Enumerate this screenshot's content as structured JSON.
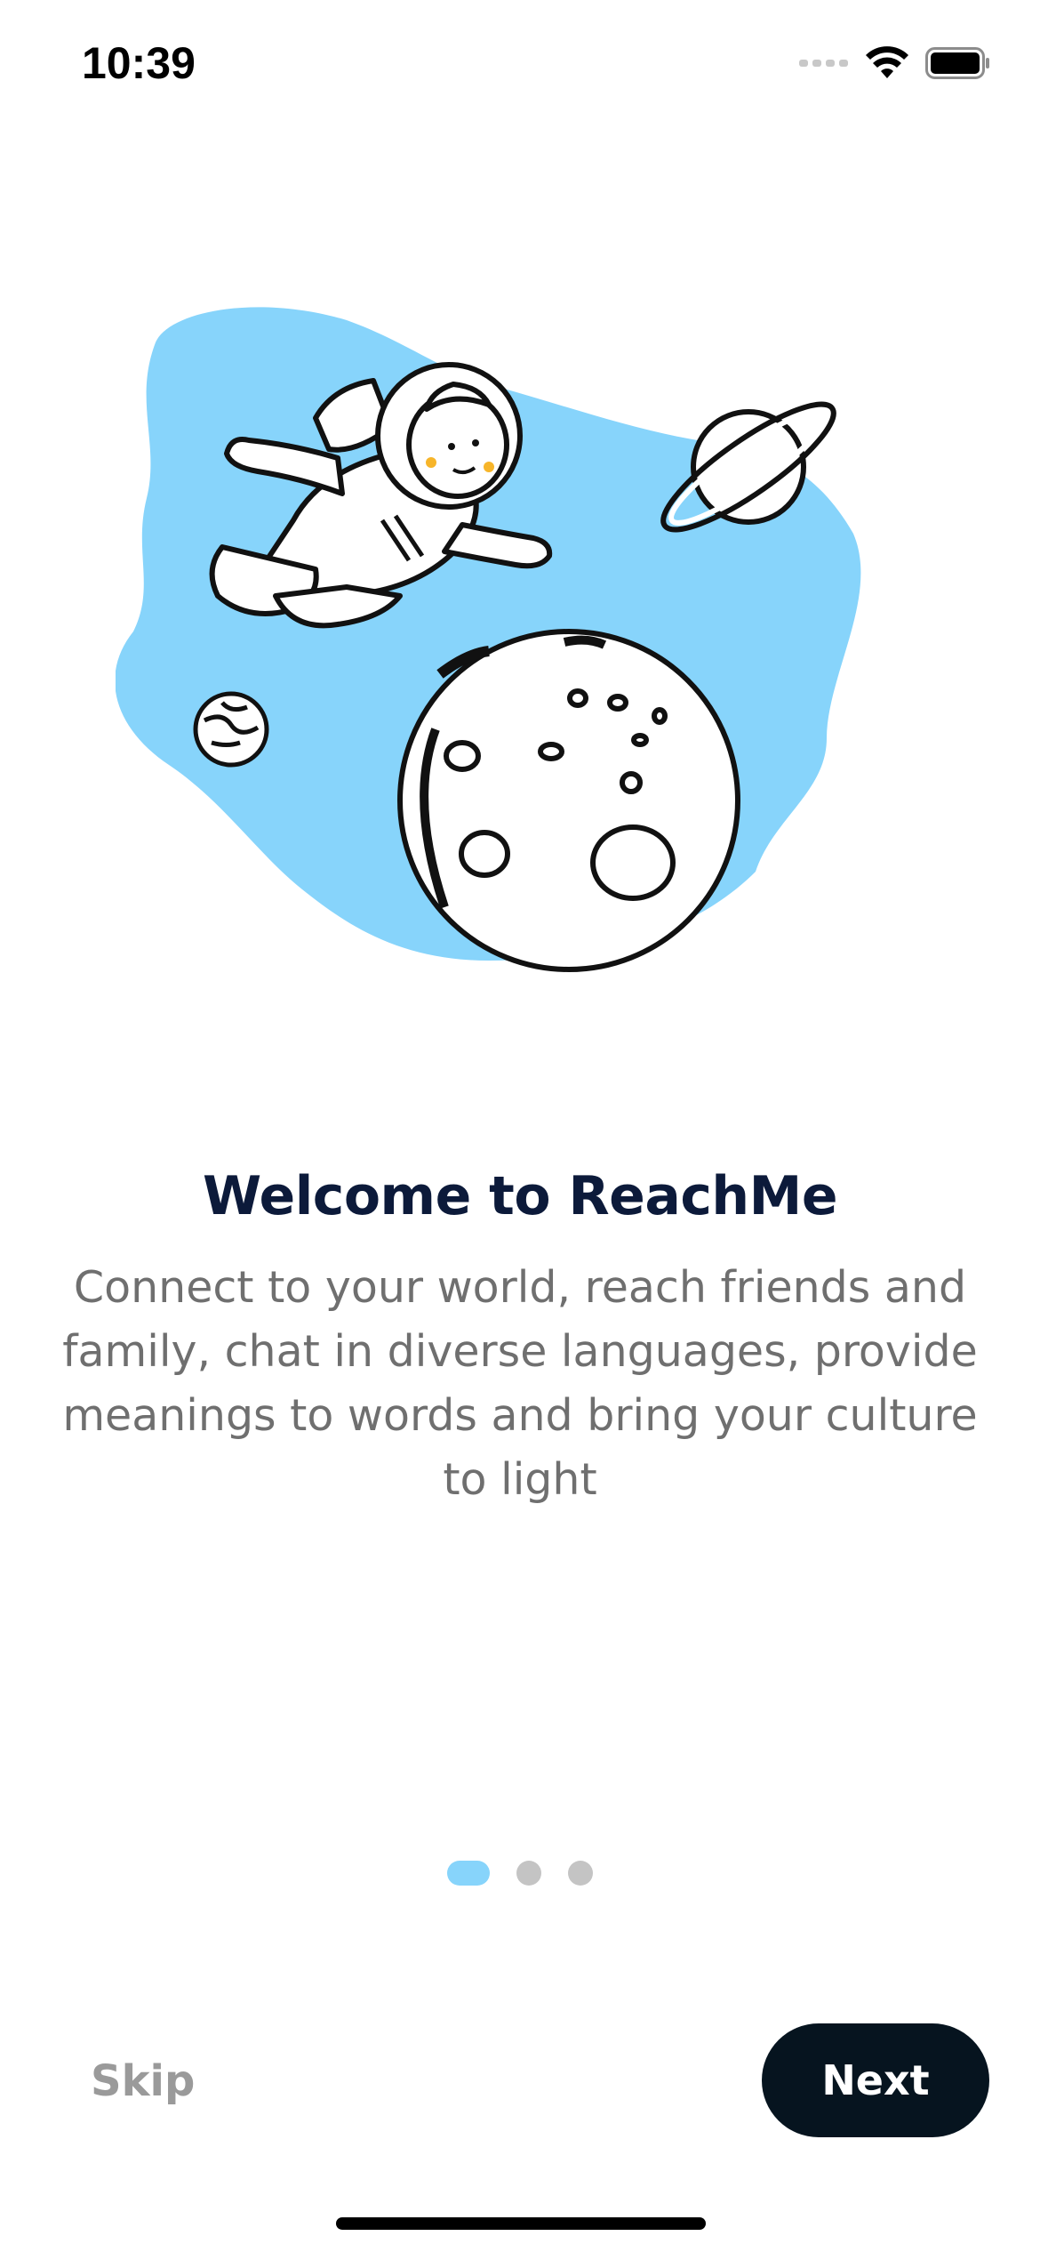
{
  "status_bar": {
    "time": "10:39",
    "icons": [
      "signal-dots-icon",
      "wifi-icon",
      "battery-icon"
    ]
  },
  "onboarding": {
    "illustration": "astronaut-space-illustration",
    "title": "Welcome to ReachMe",
    "description": "Connect to your world, reach friends and family, chat in diverse languages, provide meanings to words and bring your culture to light",
    "pages_total": 3,
    "current_page": 1
  },
  "actions": {
    "skip_label": "Skip",
    "next_label": "Next"
  },
  "colors": {
    "accent": "#87d4fb",
    "title": "#0c1a3a",
    "body_text": "#6f6f6f",
    "button_bg": "#06141f",
    "inactive_dot": "#c4c4c4"
  }
}
